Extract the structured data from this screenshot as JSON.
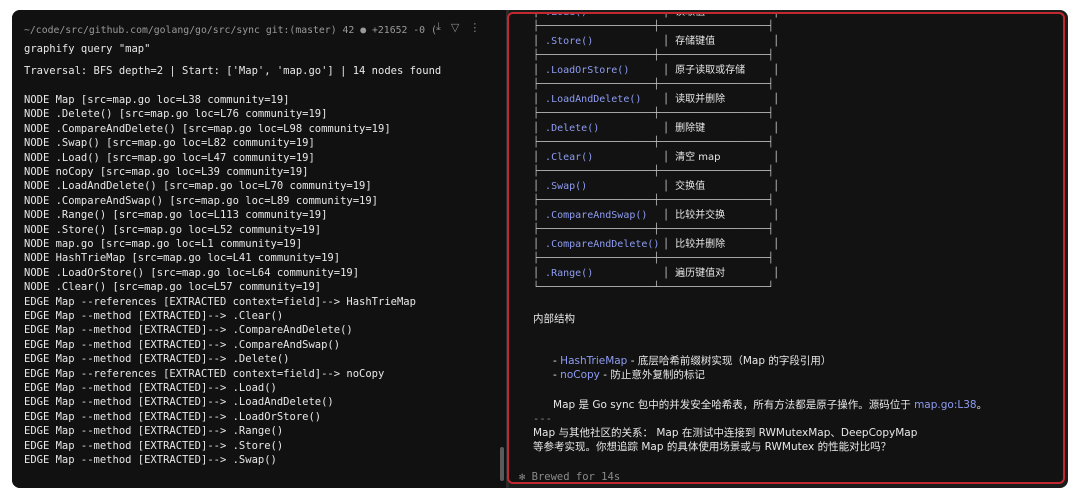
{
  "left": {
    "prompt": "~/code/src/github.com/golang/go/src/sync git:(master) 42 ● +21652 -0 (",
    "command": "graphify query \"map\"",
    "traversal": "Traversal: BFS depth=2 | Start: ['Map', 'map.go'] | 14 nodes found",
    "lines": [
      "NODE Map [src=map.go loc=L38 community=19]",
      "NODE .Delete() [src=map.go loc=L76 community=19]",
      "NODE .CompareAndDelete() [src=map.go loc=L98 community=19]",
      "NODE .Swap() [src=map.go loc=L82 community=19]",
      "NODE .Load() [src=map.go loc=L47 community=19]",
      "NODE noCopy [src=map.go loc=L39 community=19]",
      "NODE .LoadAndDelete() [src=map.go loc=L70 community=19]",
      "NODE .CompareAndSwap() [src=map.go loc=L89 community=19]",
      "NODE .Range() [src=map.go loc=L113 community=19]",
      "NODE .Store() [src=map.go loc=L52 community=19]",
      "NODE map.go [src=map.go loc=L1 community=19]",
      "NODE HashTrieMap [src=map.go loc=L41 community=19]",
      "NODE .LoadOrStore() [src=map.go loc=L64 community=19]",
      "NODE .Clear() [src=map.go loc=L57 community=19]",
      "EDGE Map --references [EXTRACTED context=field]--> HashTrieMap",
      "EDGE Map --method [EXTRACTED]--> .Clear()",
      "EDGE Map --method [EXTRACTED]--> .CompareAndDelete()",
      "EDGE Map --method [EXTRACTED]--> .CompareAndSwap()",
      "EDGE Map --method [EXTRACTED]--> .Delete()",
      "EDGE Map --references [EXTRACTED context=field]--> noCopy",
      "EDGE Map --method [EXTRACTED]--> .Load()",
      "EDGE Map --method [EXTRACTED]--> .LoadAndDelete()",
      "EDGE Map --method [EXTRACTED]--> .LoadOrStore()",
      "EDGE Map --method [EXTRACTED]--> .Range()",
      "EDGE Map --method [EXTRACTED]--> .Store()",
      "EDGE Map --method [EXTRACTED]--> .Swap()"
    ]
  },
  "toolbar": {
    "download_glyph": "⤓",
    "filter_glyph": "▽",
    "more_glyph": "⋮"
  },
  "right": {
    "table": {
      "rows": [
        {
          "method": ".Load()",
          "desc": "读取值"
        },
        {
          "method": ".Store()",
          "desc": "存储键值"
        },
        {
          "method": ".LoadOrStore()",
          "desc": "原子读取或存储"
        },
        {
          "method": ".LoadAndDelete()",
          "desc": "读取并删除"
        },
        {
          "method": ".Delete()",
          "desc": "删除键"
        },
        {
          "method": ".Clear()",
          "desc": "清空 map"
        },
        {
          "method": ".Swap()",
          "desc": "交换值"
        },
        {
          "method": ".CompareAndSwap()",
          "desc": "比较并交换"
        },
        {
          "method": ".CompareAndDelete()",
          "desc": "比较并删除"
        },
        {
          "method": ".Range()",
          "desc": "遍历键值对"
        }
      ]
    },
    "internal_heading": "内部结构",
    "bullets": [
      {
        "prefix": "- ",
        "link": "HashTrieMap",
        "text": " - 底层哈希前缀树实现（Map 的字段引用）"
      },
      {
        "prefix": "- ",
        "link": "noCopy",
        "text": " - 防止意外复制的标记"
      }
    ],
    "summary_before": "Map 是 Go sync 包中的并发安全哈希表，所有方法都是原子操作。源码位于 ",
    "summary_link": "map.go:L38",
    "summary_after": "。",
    "rule": "---",
    "relation_line1": "Map 与其他社区的关系： Map 在测试中连接到 RWMutexMap、DeepCopyMap",
    "relation_line2": "等参考实现。你想追踪 Map 的具体使用场景或与 RWMutex 的性能对比吗？",
    "brewed": "✻ Brewed for 14s"
  },
  "colors": {
    "accent_link": "#8e9cf2",
    "focus_border": "#c0292f",
    "background": "#111111"
  }
}
